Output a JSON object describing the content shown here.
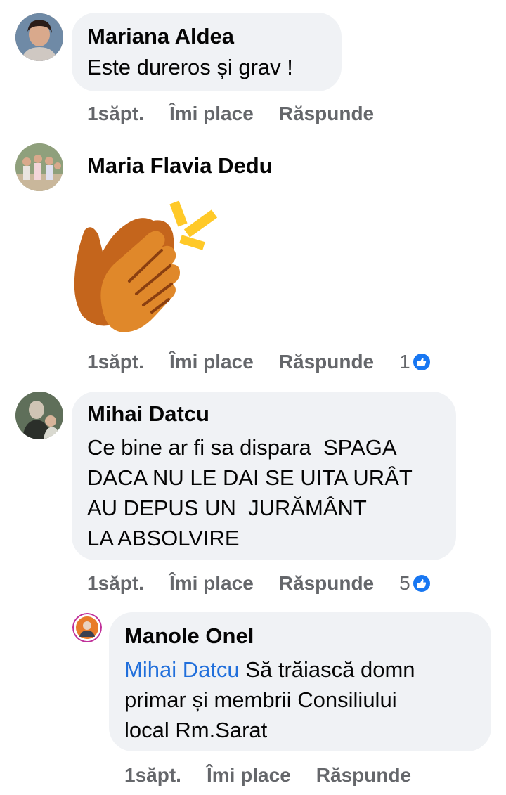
{
  "comments": [
    {
      "author": "Mariana Aldea",
      "text": "Este dureros și grav !",
      "time": "1săpt.",
      "like_label": "Îmi place",
      "reply_label": "Răspunde"
    },
    {
      "author": "Maria Flavia Dedu",
      "sticker": "clapping-hands",
      "time": "1săpt.",
      "like_label": "Îmi place",
      "reply_label": "Răspunde",
      "reaction_count": "1"
    },
    {
      "author": "Mihai Datcu",
      "lines": [
        "Ce bine ar fi sa dispara  SPAGA",
        "DACA NU LE DAI SE UITA URÂT",
        "AU DEPUS UN  JURĂMÂNT",
        "LA ABSOLVIRE"
      ],
      "time": "1săpt.",
      "like_label": "Îmi place",
      "reply_label": "Răspunde",
      "reaction_count": "5"
    }
  ],
  "reply": {
    "author": "Manole Onel",
    "mention": "Mihai Datcu",
    "line1_rest": " Să trăiască domn",
    "line2": "primar și membrii Consiliului",
    "line3": "local Rm.Sarat",
    "time": "1săpt.",
    "like_label": "Îmi place",
    "reply_label": "Răspunde"
  },
  "colors": {
    "bubble": "#f0f2f5",
    "action_text": "#65676b",
    "like_blue": "#1877f2",
    "mention": "#216fdb"
  }
}
